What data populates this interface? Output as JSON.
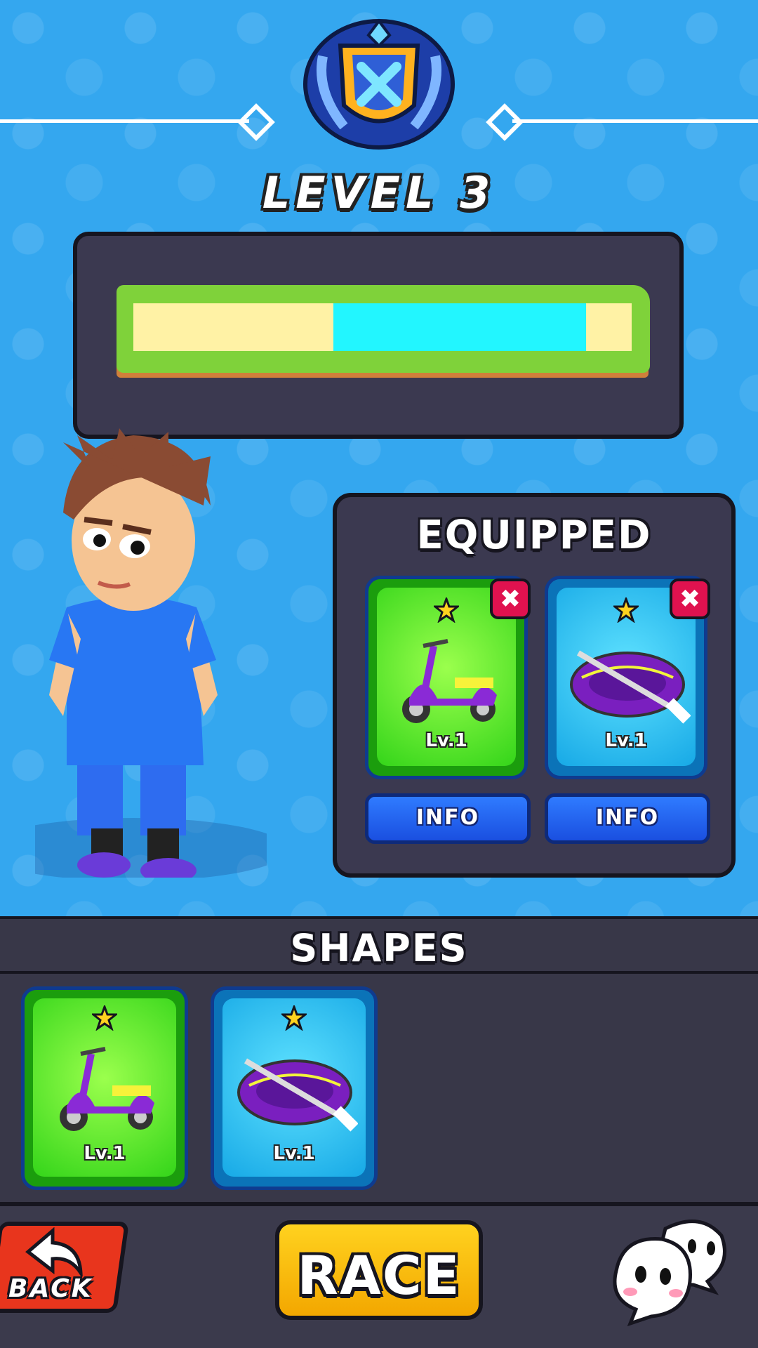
{
  "header": {
    "level_title": "LEVEL 3"
  },
  "progress": {
    "segments": [
      "yellow",
      "cyan",
      "yellow"
    ],
    "colors": {
      "yellow": "#fff2a5",
      "cyan": "#22f6ff",
      "grass": "#7fd23a",
      "dirt": "#d0803a"
    }
  },
  "equipped": {
    "title": "EQUIPPED",
    "items": [
      {
        "name": "scooter",
        "level": "Lv.1",
        "info_label": "INFO",
        "icon": "scooter-icon"
      },
      {
        "name": "raft",
        "level": "Lv.1",
        "info_label": "INFO",
        "icon": "raft-icon"
      }
    ]
  },
  "shapes": {
    "title": "SHAPES",
    "items": [
      {
        "name": "scooter",
        "level": "Lv.1",
        "icon": "scooter-icon"
      },
      {
        "name": "raft",
        "level": "Lv.1",
        "icon": "raft-icon"
      }
    ]
  },
  "bottom": {
    "back_label": "BACK",
    "race_label": "RACE"
  },
  "colors": {
    "accent_yellow": "#ffd21f",
    "remove_red": "#e0124f",
    "info_blue": "#2f7bff",
    "back_red": "#e8351d"
  }
}
